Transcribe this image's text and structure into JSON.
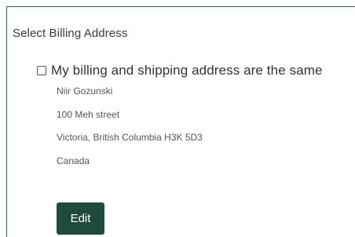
{
  "section": {
    "title": "Select Billing Address"
  },
  "same_address": {
    "label": "My billing and shipping address are the same",
    "checked": false
  },
  "address": {
    "lines": [
      "Niir Gozunski",
      "100 Meh street",
      "Victoria, British Columbia H3K 5D3",
      "Canada"
    ]
  },
  "actions": {
    "edit_label": "Edit"
  },
  "colors": {
    "border_accent": "#2f5f3f",
    "button_bg": "#1e4b3d",
    "button_text": "#ffffff"
  }
}
